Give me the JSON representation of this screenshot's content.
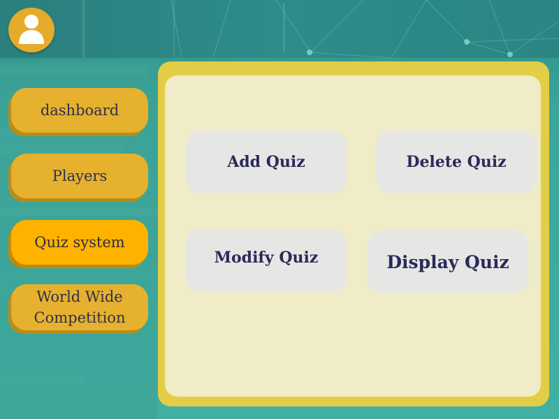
{
  "nav": {
    "dashboard": "dashboard",
    "players": "Players",
    "quiz_system": "Quiz system",
    "competition_line1": "World Wide",
    "competition_line2": "Competition"
  },
  "actions": {
    "add": "Add Quiz",
    "delete": "Delete Quiz",
    "modify": "Modify Quiz",
    "display": "Display Quiz"
  },
  "icons": {
    "avatar": "user-avatar-icon"
  },
  "colors": {
    "accent": "#e5b12e",
    "active": "#ffb300",
    "panel": "#e4cd46",
    "panel_inner": "#f0ecc7",
    "text": "#2a2a5a",
    "background": "#3aa598"
  }
}
